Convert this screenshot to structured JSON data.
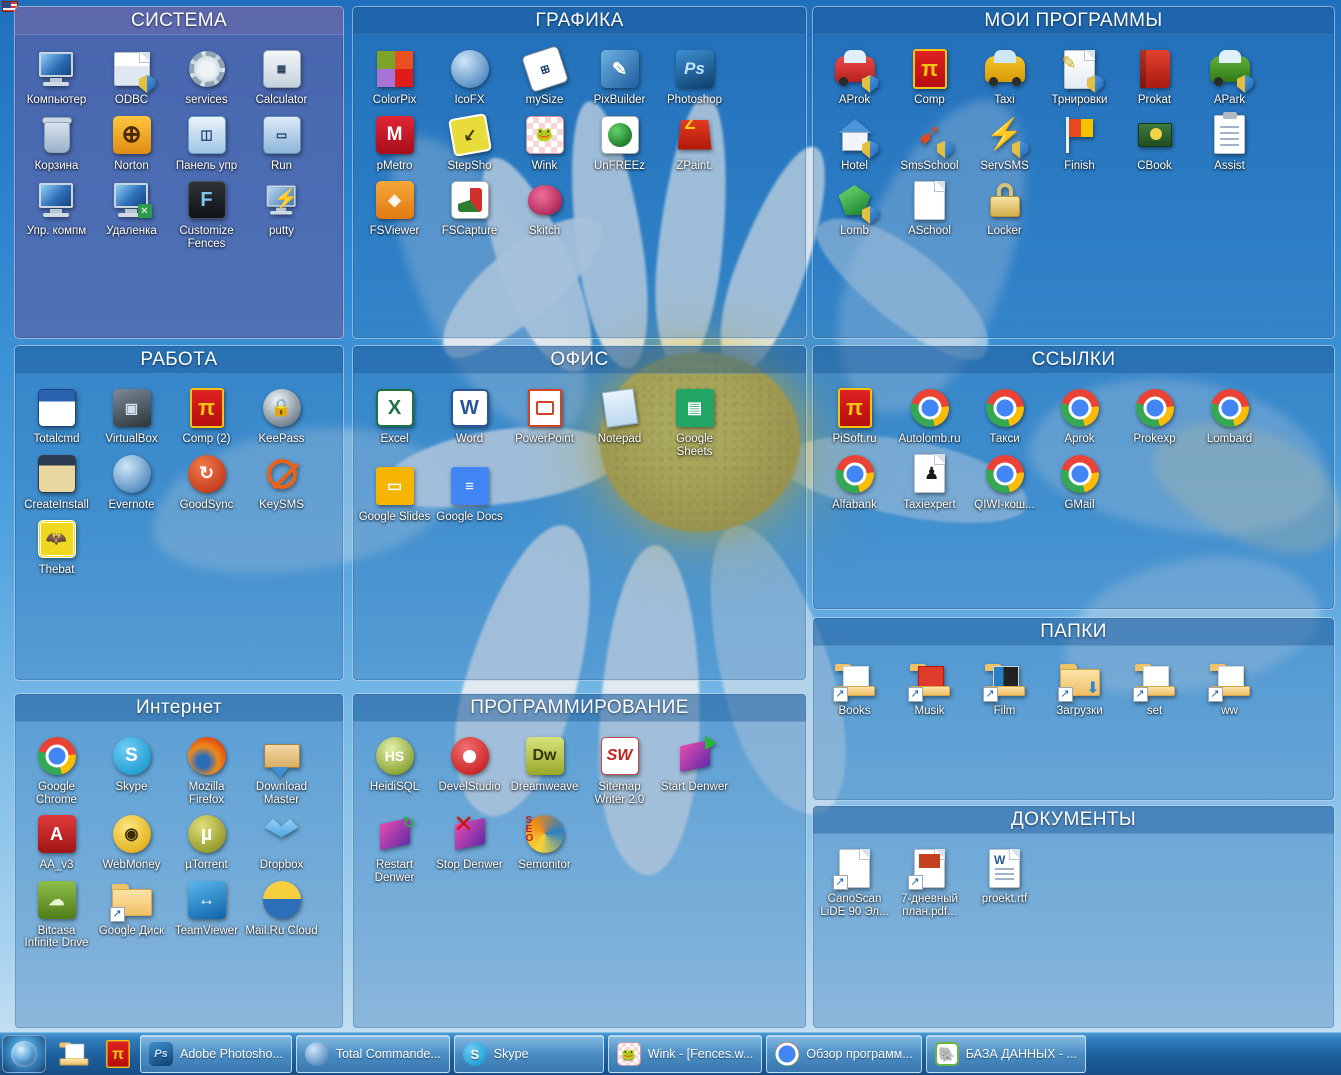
{
  "desktop": {
    "wallpaper_description": "chamomile daisy flower on blue sky",
    "tray_flag_icon": "russian-flag-icon"
  },
  "colors": {
    "fence_blue": "#286eb4",
    "fence_violet": "#5f5fa5",
    "title_bar": "#195596",
    "taskbar_top": "#4b9ad4",
    "taskbar_bottom": "#174f88",
    "label_text": "#ffffff"
  },
  "fences": [
    {
      "id": "system",
      "title": "СИСТЕМА",
      "style": "violet",
      "icons": [
        {
          "label": "Компьютер",
          "icon": "computer-icon"
        },
        {
          "label": "ODBC",
          "icon": "odbc-icon"
        },
        {
          "label": "services",
          "icon": "services-gear-icon"
        },
        {
          "label": "Calculator",
          "icon": "calculator-icon"
        },
        {
          "label": "Корзина",
          "icon": "recycle-bin-icon"
        },
        {
          "label": "Norton",
          "icon": "norton-globe-icon"
        },
        {
          "label": "Панель упр",
          "icon": "control-panel-icon"
        },
        {
          "label": "Run",
          "icon": "run-icon"
        },
        {
          "label": "Упр. компм",
          "icon": "computer-management-icon"
        },
        {
          "label": "Удаленка",
          "icon": "remote-desktop-icon"
        },
        {
          "label": "Customize Fences",
          "icon": "fences-icon"
        },
        {
          "label": "putty",
          "icon": "putty-icon"
        }
      ]
    },
    {
      "id": "graphics",
      "title": "ГРАФИКА",
      "style": "blue",
      "icons": [
        {
          "label": "ColorPix",
          "icon": "colorpix-icon"
        },
        {
          "label": "IcoFX",
          "icon": "icofx-icon"
        },
        {
          "label": "mySize",
          "icon": "mysize-icon"
        },
        {
          "label": "PixBuilder",
          "icon": "pixbuilder-icon"
        },
        {
          "label": "Photoshop",
          "icon": "photoshop-icon"
        },
        {
          "label": "pMetro",
          "icon": "pmetro-icon"
        },
        {
          "label": "StepSho",
          "icon": "stepshot-icon"
        },
        {
          "label": "Wink",
          "icon": "wink-icon"
        },
        {
          "label": "UnFREEz",
          "icon": "unfreez-icon"
        },
        {
          "label": "ZPaint.",
          "icon": "zpaint-icon"
        },
        {
          "label": "FSViewer",
          "icon": "fsviewer-eye-icon"
        },
        {
          "label": "FSCapture",
          "icon": "fscapture-icon"
        },
        {
          "label": "Skitch",
          "icon": "skitch-icon"
        }
      ]
    },
    {
      "id": "my_programs",
      "title": "МОИ ПРОГРАММЫ",
      "style": "blue",
      "icons": [
        {
          "label": "APark",
          "icon": "apark-car-icon"
        },
        {
          "label": "Comp",
          "icon": "comp-pi-icon"
        },
        {
          "label": "Taxi",
          "icon": "taxi-car-icon"
        },
        {
          "label": "Трнировки",
          "icon": "training-notebook-icon"
        },
        {
          "label": "Prokat",
          "icon": "prokat-book-icon"
        },
        {
          "label": "APark",
          "icon": "apark-green-car-icon"
        },
        {
          "label": "Hotel",
          "icon": "hotel-house-icon"
        },
        {
          "label": "SmsSchool",
          "icon": "smsschool-arrow-icon"
        },
        {
          "label": "ServSMS",
          "icon": "servsms-lightning-icon"
        },
        {
          "label": "Finish",
          "icon": "finish-flag-icon"
        },
        {
          "label": "CBook",
          "icon": "cbook-money-icon"
        },
        {
          "label": "Assist",
          "icon": "assist-clipboard-icon"
        },
        {
          "label": "Lomb",
          "icon": "lomb-gem-icon"
        },
        {
          "label": "ASchool",
          "icon": "aschool-document-icon"
        },
        {
          "label": "Locker",
          "icon": "locker-padlock-icon"
        }
      ],
      "first_label_override": "AProk"
    },
    {
      "id": "work",
      "title": "РАБОТА",
      "style": "blue",
      "icons": [
        {
          "label": "Totalcmd",
          "icon": "total-commander-icon"
        },
        {
          "label": "VirtualBox",
          "icon": "virtualbox-icon"
        },
        {
          "label": "Comp (2)",
          "icon": "comp-pi-icon"
        },
        {
          "label": "KeePass",
          "icon": "keepass-icon"
        },
        {
          "label": "CreateInstall",
          "icon": "createinstall-icon"
        },
        {
          "label": "Evernote",
          "icon": "evernote-icon"
        },
        {
          "label": "GoodSync",
          "icon": "goodsync-icon"
        },
        {
          "label": "KeySMS",
          "icon": "keysms-forbidden-icon"
        },
        {
          "label": "Thebat",
          "icon": "thebat-icon"
        }
      ]
    },
    {
      "id": "office",
      "title": "ОФИС",
      "style": "blue",
      "icons": [
        {
          "label": "Excel",
          "icon": "excel-icon"
        },
        {
          "label": "Word",
          "icon": "word-icon"
        },
        {
          "label": "PowerPoint",
          "icon": "powerpoint-icon"
        },
        {
          "label": "Notepad",
          "icon": "notepad-icon"
        },
        {
          "label": "Google Sheets",
          "icon": "google-sheets-icon"
        },
        {
          "label": "Google Slides",
          "icon": "google-slides-icon"
        },
        {
          "label": "Google Docs",
          "icon": "google-docs-icon"
        }
      ]
    },
    {
      "id": "links",
      "title": "ССЫЛКИ",
      "style": "blue",
      "icons": [
        {
          "label": "PiSoft.ru",
          "icon": "pisoft-pi-icon"
        },
        {
          "label": "Autolomb.ru",
          "icon": "chrome-shortcut-icon"
        },
        {
          "label": "Такси",
          "icon": "chrome-shortcut-icon"
        },
        {
          "label": "Aprok",
          "icon": "chrome-shortcut-icon"
        },
        {
          "label": "Prokexp",
          "icon": "chrome-shortcut-icon"
        },
        {
          "label": "Lombard",
          "icon": "chrome-shortcut-icon"
        },
        {
          "label": "Alfabank",
          "icon": "chrome-shortcut-icon"
        },
        {
          "label": "Taxiexpert",
          "icon": "taxiexpert-document-icon"
        },
        {
          "label": "QIWI-кош...",
          "icon": "chrome-shortcut-icon"
        },
        {
          "label": "GMail",
          "icon": "chrome-shortcut-icon"
        }
      ]
    },
    {
      "id": "internet",
      "title": "Интернет",
      "style": "blue",
      "icons": [
        {
          "label": "Google Chrome",
          "icon": "chrome-icon"
        },
        {
          "label": "Skype",
          "icon": "skype-icon"
        },
        {
          "label": "Mozilla Firefox",
          "icon": "firefox-icon"
        },
        {
          "label": "Download Master",
          "icon": "download-master-icon"
        },
        {
          "label": "AA_v3",
          "icon": "aa-v3-icon"
        },
        {
          "label": "WebMoney",
          "icon": "webmoney-icon"
        },
        {
          "label": "µTorrent",
          "icon": "utorrent-icon"
        },
        {
          "label": "Dropbox",
          "icon": "dropbox-icon"
        },
        {
          "label": "Bitcasa Infinite Drive",
          "icon": "bitcasa-icon"
        },
        {
          "label": "Google Диск",
          "icon": "google-drive-icon"
        },
        {
          "label": "TeamViewer",
          "icon": "teamviewer-icon"
        },
        {
          "label": "Mail.Ru Cloud",
          "icon": "mailru-cloud-icon"
        }
      ]
    },
    {
      "id": "programming",
      "title": "ПРОГРАММИРОВАНИЕ",
      "style": "blue",
      "icons": [
        {
          "label": "HeidiSQL",
          "icon": "heidisql-icon"
        },
        {
          "label": "DevelStudio",
          "icon": "develstudio-icon"
        },
        {
          "label": "Dreamweave",
          "icon": "dreamweaver-icon"
        },
        {
          "label": "Sitemap Writer 2.0",
          "icon": "sitemap-writer-icon"
        },
        {
          "label": "Start Denwer",
          "icon": "start-denwer-icon"
        },
        {
          "label": "Restart Denwer",
          "icon": "restart-denwer-icon"
        },
        {
          "label": "Stop Denwer",
          "icon": "stop-denwer-icon"
        },
        {
          "label": "Semonitor",
          "icon": "semonitor-icon"
        }
      ]
    },
    {
      "id": "folders",
      "title": "ПАПКИ",
      "style": "blue",
      "icons": [
        {
          "label": "Books",
          "icon": "folder-shortcut-icon"
        },
        {
          "label": "Musik",
          "icon": "folder-shortcut-icon"
        },
        {
          "label": "Film",
          "icon": "folder-shortcut-icon"
        },
        {
          "label": "Загрузки",
          "icon": "downloads-folder-shortcut-icon"
        },
        {
          "label": "set",
          "icon": "folder-shortcut-icon"
        },
        {
          "label": "ww",
          "icon": "folder-shortcut-icon"
        }
      ]
    },
    {
      "id": "documents",
      "title": "ДОКУМЕНТЫ",
      "style": "blue",
      "icons": [
        {
          "label": "CanoScan LiDE 90 Эл...",
          "icon": "document-shortcut-icon"
        },
        {
          "label": "7-дневный план.pdf...",
          "icon": "pdf-shortcut-icon"
        },
        {
          "label": "proekt.rtf",
          "icon": "rtf-document-icon"
        }
      ]
    }
  ],
  "taskbar": {
    "start_button": "start-orb-icon",
    "quick_launch": [
      {
        "name": "explorer-icon",
        "label": "Проводник"
      },
      {
        "name": "comp-pi-icon",
        "label": "Comp"
      }
    ],
    "tasks": [
      {
        "label": "Adobe Photosho...",
        "icon": "photoshop-icon"
      },
      {
        "label": "Total Commande...",
        "icon": "total-commander-icon"
      },
      {
        "label": "Skype",
        "icon": "skype-icon"
      },
      {
        "label": "Wink - [Fences.w...",
        "icon": "wink-icon"
      },
      {
        "label": "Обзор программ...",
        "icon": "chrome-icon"
      },
      {
        "label": "БАЗА ДАННЫХ - ...",
        "icon": "evernote-icon"
      }
    ]
  }
}
